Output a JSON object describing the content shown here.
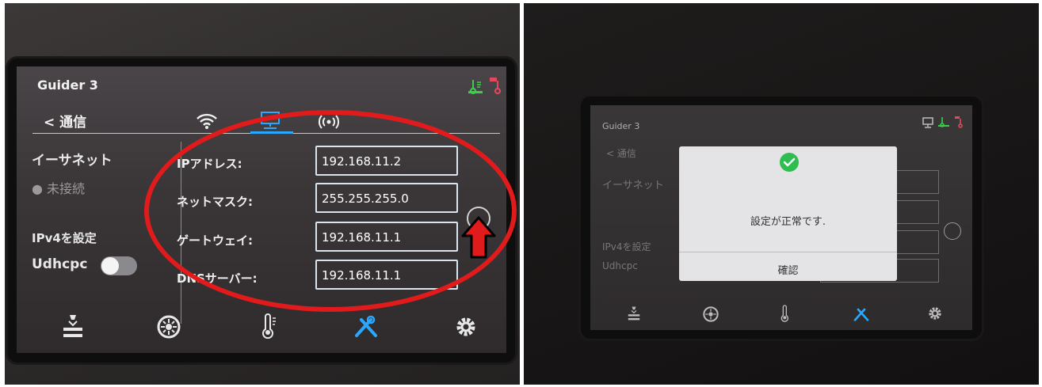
{
  "left_screen": {
    "title": "Guider 3",
    "back_label": "< 通信",
    "section_title": "イーサネット",
    "status": "● 未接続",
    "ipv4_label": "IPv4を設定",
    "udhcpc_label": "Udhcpc",
    "udhcpc_enabled": false,
    "fields": [
      {
        "label": "IPアドレス:",
        "value": "192.168.11.2"
      },
      {
        "label": "ネットマスク:",
        "value": "255.255.255.0"
      },
      {
        "label": "ゲートウェイ:",
        "value": "192.168.11.1"
      },
      {
        "label": "DNSサーバー:",
        "value": "192.168.11.1"
      }
    ],
    "tabs": [
      "wifi-icon",
      "ethernet-icon",
      "hotspot-icon"
    ],
    "active_tab": "ethernet-icon",
    "status_icons": [
      "bed-temp-icon",
      "nozzle-temp-icon"
    ],
    "nav": [
      "print-icon",
      "filament-icon",
      "thermometer-icon",
      "tools-icon",
      "settings-icon"
    ],
    "active_nav": "tools-icon"
  },
  "right_screen": {
    "title": "Guider 3",
    "back_label": "< 通信",
    "section_title": "イーサネット",
    "ipv4_label": "IPv4を設定",
    "udhcpc_label": "Udhcpc",
    "dialog": {
      "message": "設定が正常です.",
      "confirm_label": "確認"
    }
  },
  "colors": {
    "accent": "#2aa8ff",
    "annotation_red": "#e11b1b",
    "success_green": "#2ebd4f"
  }
}
